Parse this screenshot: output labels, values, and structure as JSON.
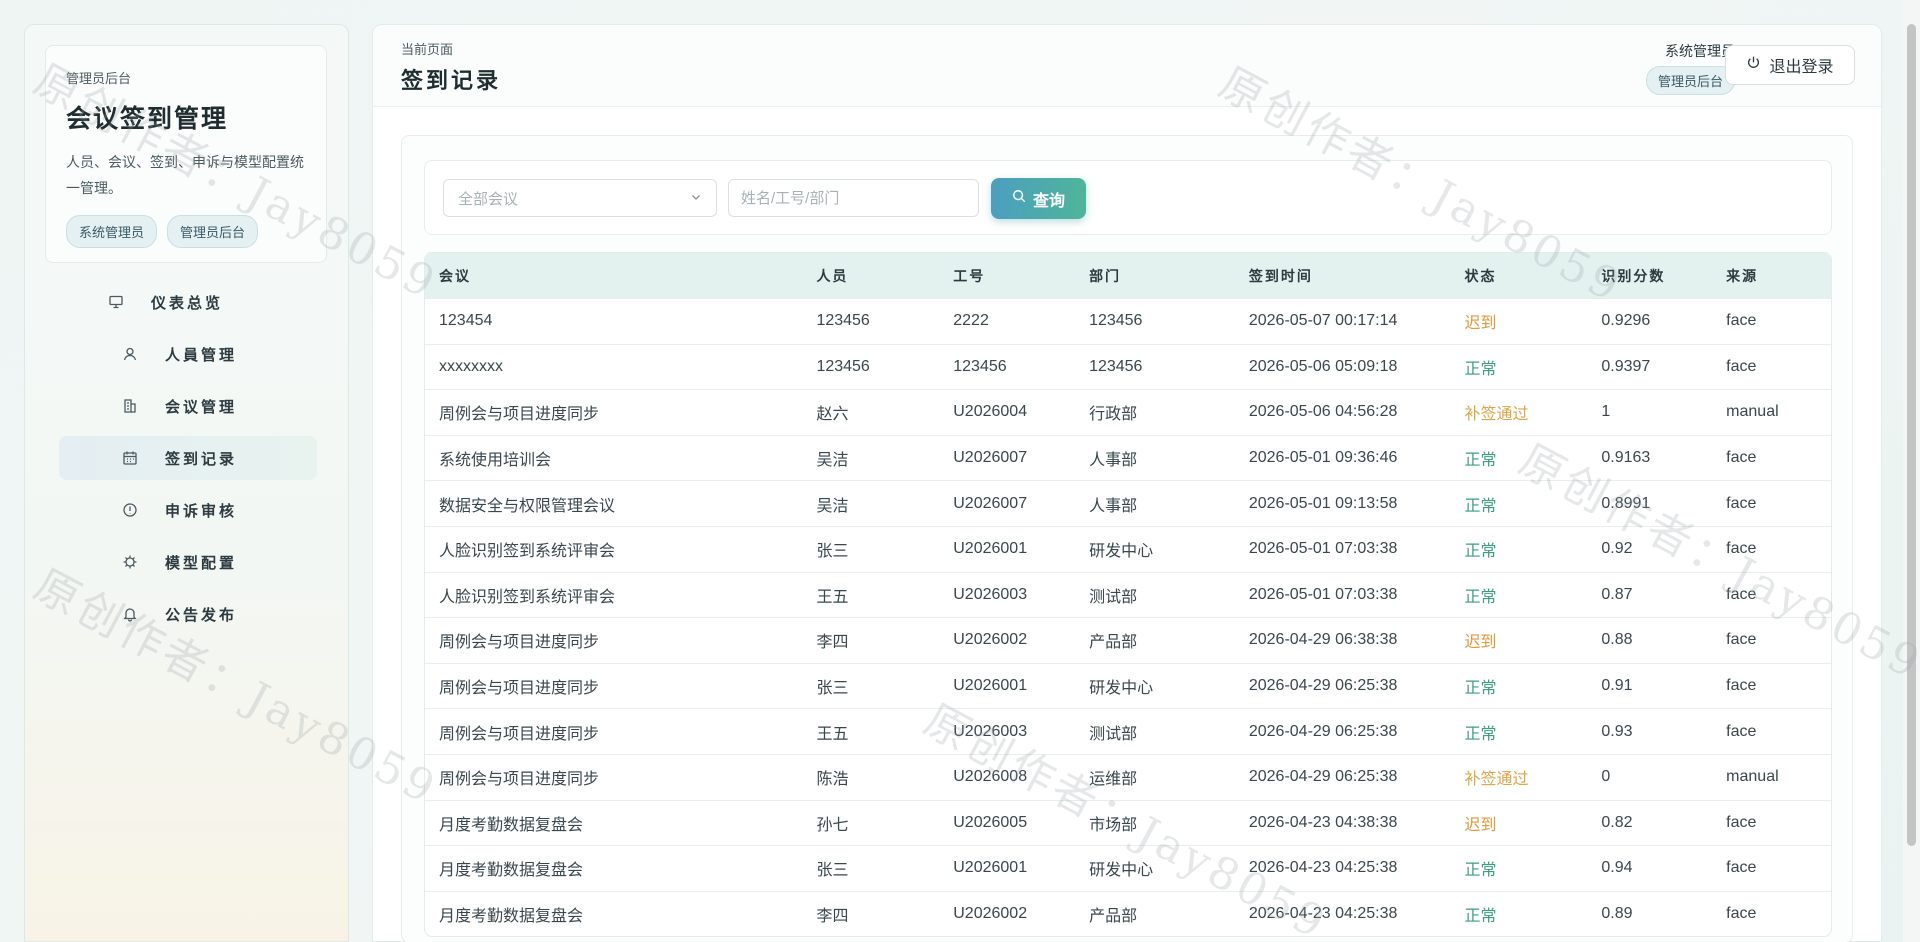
{
  "sidebar": {
    "subtitle": "管理员后台",
    "title": "会议签到管理",
    "description": "人员、会议、签到、申诉与模型配置统一管理。",
    "chips": [
      "系统管理员",
      "管理员后台"
    ],
    "nav": [
      {
        "label": "仪表总览",
        "icon": "presentation-icon"
      },
      {
        "label": "人員管理",
        "icon": "user-icon"
      },
      {
        "label": "会议管理",
        "icon": "building-icon"
      },
      {
        "label": "签到记录",
        "icon": "calendar-icon"
      },
      {
        "label": "申诉审核",
        "icon": "alert-circle-icon"
      },
      {
        "label": "模型配置",
        "icon": "chip-icon"
      },
      {
        "label": "公告发布",
        "icon": "bell-icon"
      }
    ]
  },
  "header": {
    "crumb": "当前页面",
    "title": "签到记录",
    "user_name": "系统管理员",
    "user_role": "管理员后台",
    "logout_label": "退出登录"
  },
  "filter": {
    "meeting_select": "全部会议",
    "search_placeholder": "姓名/工号/部门",
    "query_label": "查询"
  },
  "table": {
    "headers": [
      "会议",
      "人员",
      "工号",
      "部门",
      "签到时间",
      "状态",
      "识别分数",
      "来源"
    ],
    "rows": [
      [
        "123454",
        "123456",
        "2222",
        "123456",
        "2026-05-07 00:17:14",
        "迟到",
        "0.9296",
        "face"
      ],
      [
        "xxxxxxxx",
        "123456",
        "123456",
        "123456",
        "2026-05-06 05:09:18",
        "正常",
        "0.9397",
        "face"
      ],
      [
        "周例会与项目进度同步",
        "赵六",
        "U2026004",
        "行政部",
        "2026-05-06 04:56:28",
        "补签通过",
        "1",
        "manual"
      ],
      [
        "系统使用培训会",
        "吴洁",
        "U2026007",
        "人事部",
        "2026-05-01 09:36:46",
        "正常",
        "0.9163",
        "face"
      ],
      [
        "数据安全与权限管理会议",
        "吴洁",
        "U2026007",
        "人事部",
        "2026-05-01 09:13:58",
        "正常",
        "0.8991",
        "face"
      ],
      [
        "人脸识别签到系统评审会",
        "张三",
        "U2026001",
        "研发中心",
        "2026-05-01 07:03:38",
        "正常",
        "0.92",
        "face"
      ],
      [
        "人脸识别签到系统评审会",
        "王五",
        "U2026003",
        "测试部",
        "2026-05-01 07:03:38",
        "正常",
        "0.87",
        "face"
      ],
      [
        "周例会与项目进度同步",
        "李四",
        "U2026002",
        "产品部",
        "2026-04-29 06:38:38",
        "迟到",
        "0.88",
        "face"
      ],
      [
        "周例会与项目进度同步",
        "张三",
        "U2026001",
        "研发中心",
        "2026-04-29 06:25:38",
        "正常",
        "0.91",
        "face"
      ],
      [
        "周例会与项目进度同步",
        "王五",
        "U2026003",
        "测试部",
        "2026-04-29 06:25:38",
        "正常",
        "0.93",
        "face"
      ],
      [
        "周例会与项目进度同步",
        "陈浩",
        "U2026008",
        "运维部",
        "2026-04-29 06:25:38",
        "补签通过",
        "0",
        "manual"
      ],
      [
        "月度考勤数据复盘会",
        "孙七",
        "U2026005",
        "市场部",
        "2026-04-23 04:38:38",
        "迟到",
        "0.82",
        "face"
      ],
      [
        "月度考勤数据复盘会",
        "张三",
        "U2026001",
        "研发中心",
        "2026-04-23 04:25:38",
        "正常",
        "0.94",
        "face"
      ],
      [
        "月度考勤数据复盘会",
        "李四",
        "U2026002",
        "产品部",
        "2026-04-23 04:25:38",
        "正常",
        "0.89",
        "face"
      ]
    ]
  },
  "watermark": "原创作者：Jay8059",
  "colors": {
    "accent_start": "#4b9fbf",
    "accent_end": "#4fb59a",
    "status_normal": "#3aa07e",
    "status_late": "#e29a3a"
  }
}
